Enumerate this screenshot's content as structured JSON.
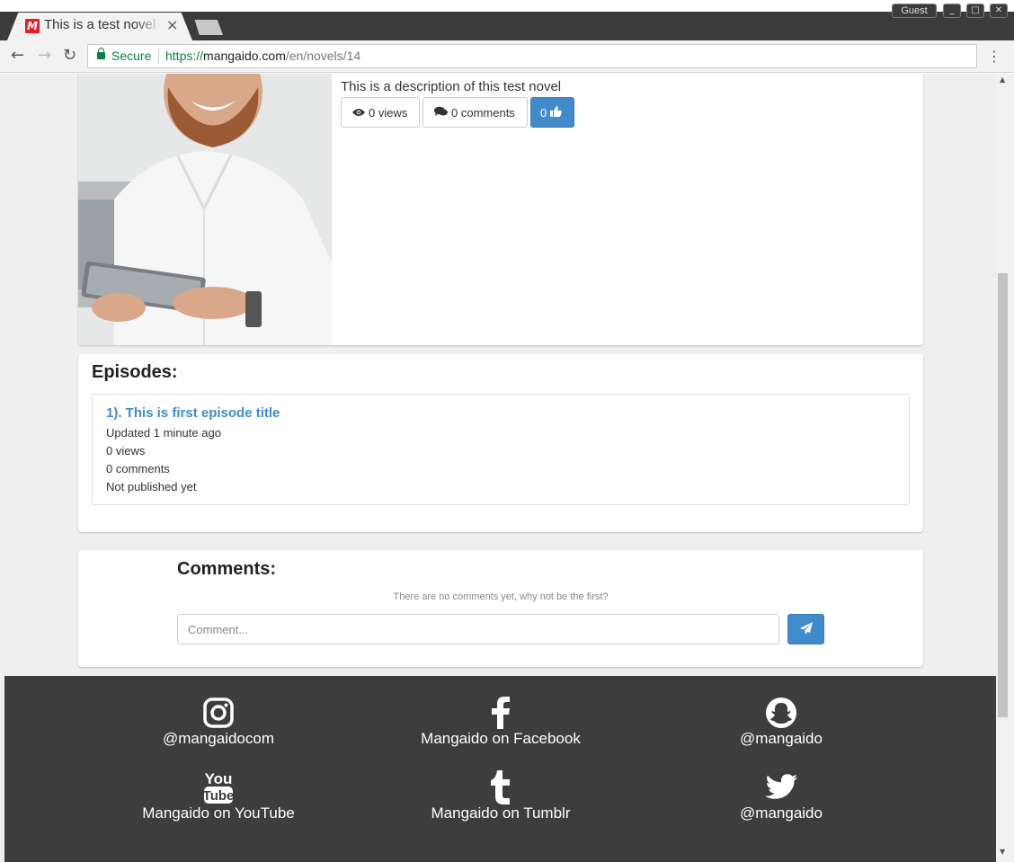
{
  "browser": {
    "tab_title": "This is a test novel - Mangaido",
    "tab_close": "×",
    "window_user": "Guest",
    "secure_label": "Secure",
    "url_scheme": "https://",
    "url_host": "mangaido.com",
    "url_path": "/en/novels/14",
    "back_icon": "←",
    "forward_icon": "→",
    "reload_icon": "↻",
    "menu_icon": "⋮"
  },
  "novel": {
    "description": "This is a description of this test novel",
    "views_label": "0 views",
    "comments_label": "0 comments",
    "likes_count": "0"
  },
  "episodes": {
    "heading": "Episodes:",
    "items": [
      {
        "title": "1). This is first episode title",
        "updated": "Updated 1 minute ago",
        "views": "0 views",
        "comments": "0 comments",
        "status": "Not published yet"
      }
    ]
  },
  "comments": {
    "heading": "Comments:",
    "empty_text": "There are no comments yet, why not be the first?",
    "input_placeholder": "Comment..."
  },
  "footer": {
    "links": [
      {
        "icon": "instagram-icon",
        "label": "@mangaidocom"
      },
      {
        "icon": "facebook-icon",
        "label": "Mangaido on Facebook"
      },
      {
        "icon": "snapchat-icon",
        "label": "@mangaido"
      },
      {
        "icon": "youtube-icon",
        "label": "Mangaido on YouTube"
      },
      {
        "icon": "tumblr-icon",
        "label": "Mangaido on Tumblr"
      },
      {
        "icon": "twitter-icon",
        "label": "@mangaido"
      }
    ]
  },
  "colors": {
    "accent": "#428bca",
    "footer_bg": "#3d3d3d",
    "page_bg": "#efefef",
    "secure_green": "#0b8043"
  }
}
